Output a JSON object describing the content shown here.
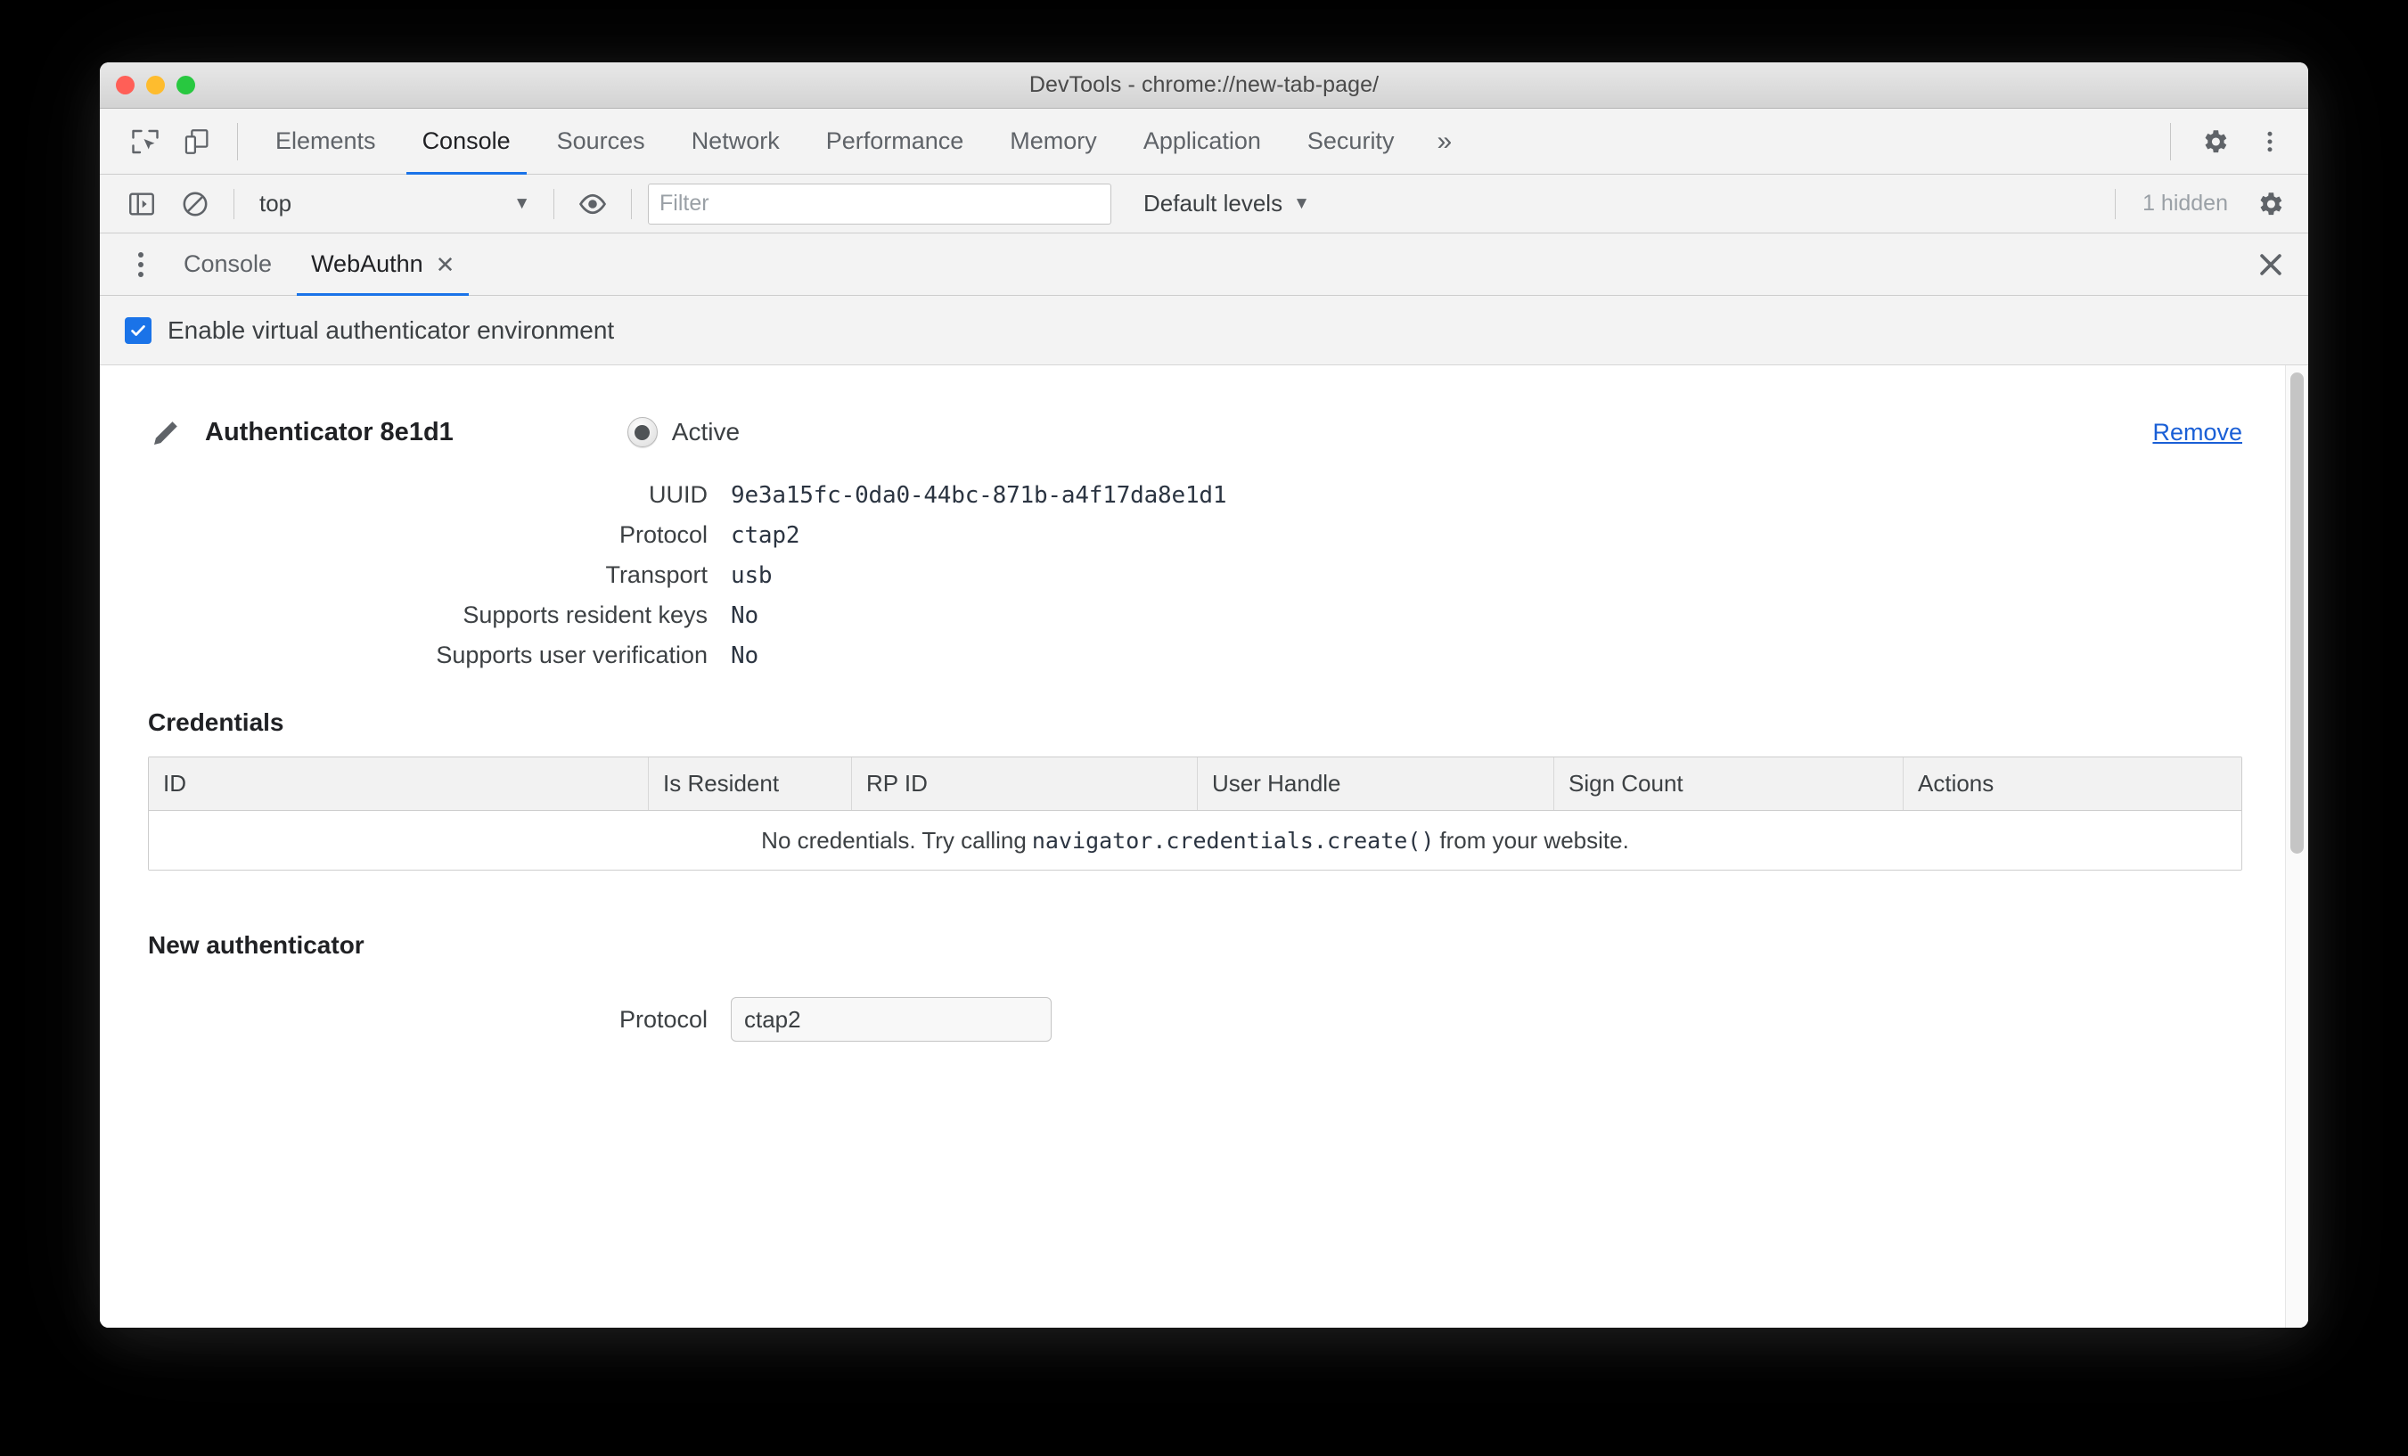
{
  "window": {
    "title": "DevTools - chrome://new-tab-page/",
    "traffic_lights": [
      "close",
      "minimize",
      "zoom"
    ],
    "colors": {
      "accent": "#1a73e8",
      "link": "#1a5fd6",
      "close_dot": "#ff5f57",
      "minimize_dot": "#febc2e",
      "zoom_dot": "#28c840",
      "text": "#3c4043",
      "toolbar_bg": "#f3f3f3"
    }
  },
  "toolbar": {
    "inspect_icon": "inspect-element-icon",
    "device_icon": "device-toolbar-icon",
    "settings_icon": "gear-icon",
    "menu_icon": "three-dot-menu-icon",
    "more_tabs_label": "»",
    "tabs": [
      {
        "label": "Elements",
        "active": false
      },
      {
        "label": "Console",
        "active": true
      },
      {
        "label": "Sources",
        "active": false
      },
      {
        "label": "Network",
        "active": false
      },
      {
        "label": "Performance",
        "active": false
      },
      {
        "label": "Memory",
        "active": false
      },
      {
        "label": "Application",
        "active": false
      },
      {
        "label": "Security",
        "active": false
      }
    ]
  },
  "console_toolbar": {
    "sidebar_icon": "console-sidebar-icon",
    "clear_icon": "clear-console-icon",
    "context_value": "top",
    "context_caret": "▼",
    "eye_icon": "live-expression-eye-icon",
    "filter_placeholder": "Filter",
    "filter_value": "",
    "levels_label": "Default levels",
    "levels_caret": "▼",
    "hidden_count": "1 hidden",
    "settings_icon": "gear-icon"
  },
  "drawer": {
    "kebab_icon": "drawer-more-tools-icon",
    "close_icon": "close-icon",
    "tabs": [
      {
        "label": "Console",
        "active": false,
        "closable": false
      },
      {
        "label": "WebAuthn",
        "active": true,
        "closable": true,
        "close_glyph": "✕"
      }
    ]
  },
  "webauthn": {
    "enable_checkbox": {
      "label": "Enable virtual authenticator environment",
      "checked": true
    },
    "authenticator": {
      "edit_icon": "pencil-edit-icon",
      "name": "Authenticator 8e1d1",
      "active_label": "Active",
      "active_selected": true,
      "remove_label": "Remove",
      "properties": [
        {
          "key": "UUID",
          "value": "9e3a15fc-0da0-44bc-871b-a4f17da8e1d1"
        },
        {
          "key": "Protocol",
          "value": "ctap2"
        },
        {
          "key": "Transport",
          "value": "usb"
        },
        {
          "key": "Supports resident keys",
          "value": "No"
        },
        {
          "key": "Supports user verification",
          "value": "No"
        }
      ]
    },
    "credentials": {
      "title": "Credentials",
      "columns": [
        "ID",
        "Is Resident",
        "RP ID",
        "User Handle",
        "Sign Count",
        "Actions"
      ],
      "rows": [],
      "empty_message_prefix": "No credentials. Try calling ",
      "empty_message_code": "navigator.credentials.create()",
      "empty_message_suffix": " from your website."
    },
    "new_authenticator": {
      "title": "New authenticator",
      "protocol_label": "Protocol",
      "protocol_value": "ctap2"
    }
  }
}
